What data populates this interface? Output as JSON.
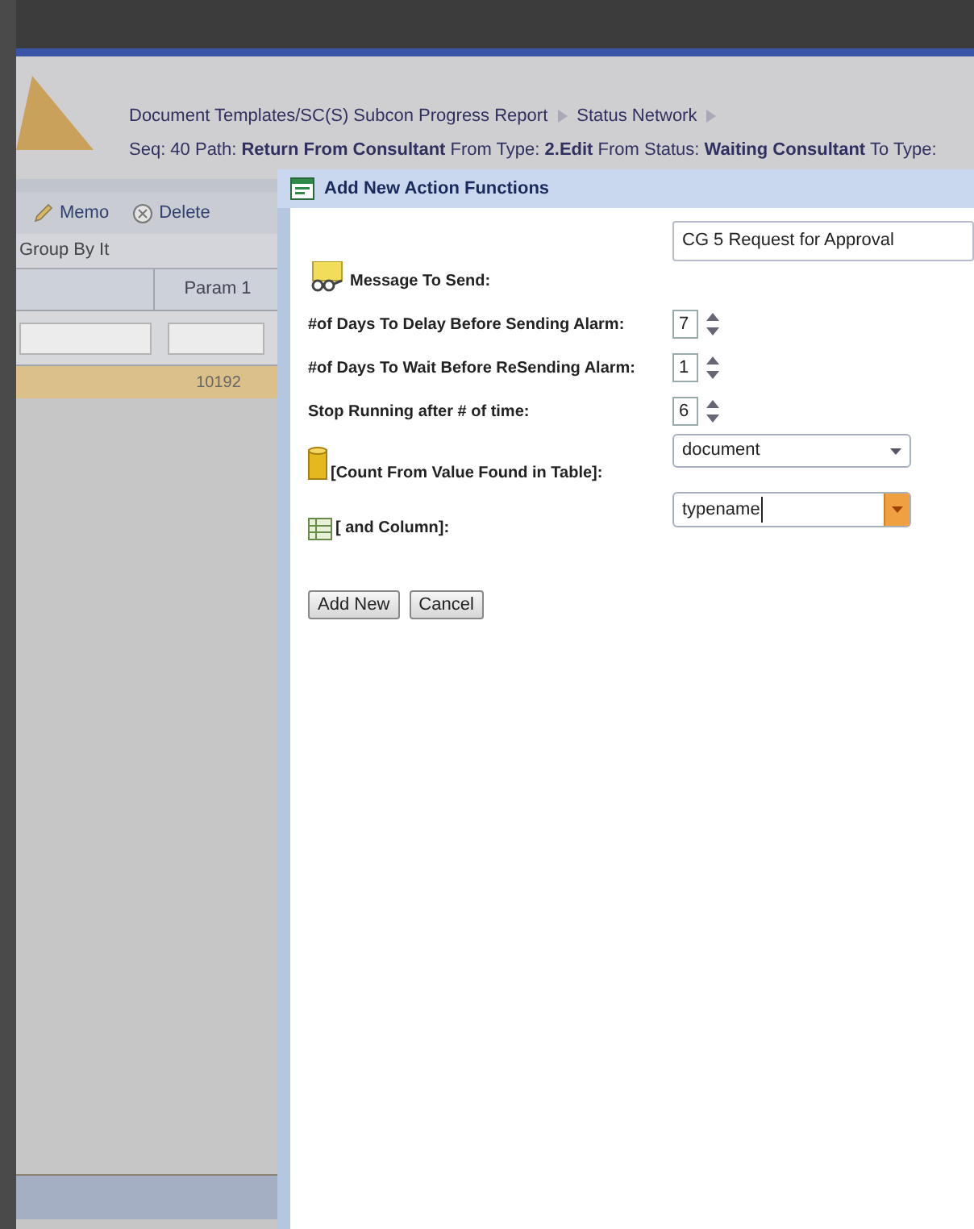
{
  "header": {
    "breadcrumb": [
      {
        "label": "Document Templates/SC(S) Subcon Progress Report"
      },
      {
        "label": "Status Network"
      }
    ],
    "path_line": "Seq: 40 Path: **Return From Consultant** From Type: **2.Edit** From Status: **Waiting Consultant** To Type:"
  },
  "toolbar": [
    {
      "label": "Memo",
      "kind": "memo"
    },
    {
      "label": "Delete",
      "kind": "delete"
    }
  ],
  "grid": {
    "group_by": "Group By It",
    "columns": [
      "",
      "Param 1"
    ],
    "rows": [
      {
        "cells": [
          "",
          "10192"
        ],
        "selected": true
      }
    ]
  },
  "dialog": {
    "title": "Add New Action Functions",
    "fields": [
      {
        "kind": "text",
        "label": "Message To Send:",
        "value": "CG 5 Request for Approval"
      },
      {
        "kind": "spin",
        "label": "#of Days To Delay Before Sending Alarm:",
        "value": "7"
      },
      {
        "kind": "spin",
        "label": "#of Days To Wait Before ReSending Alarm:",
        "value": "1"
      },
      {
        "kind": "spin",
        "label": "Stop Running after # of time:",
        "value": "6"
      },
      {
        "kind": "select",
        "label": "[Count From Value Found in Table]:",
        "value": "document"
      },
      {
        "kind": "combo",
        "label": "[ and Column]:",
        "value": "typename"
      }
    ],
    "buttons": [
      "Add New",
      "Cancel"
    ]
  }
}
